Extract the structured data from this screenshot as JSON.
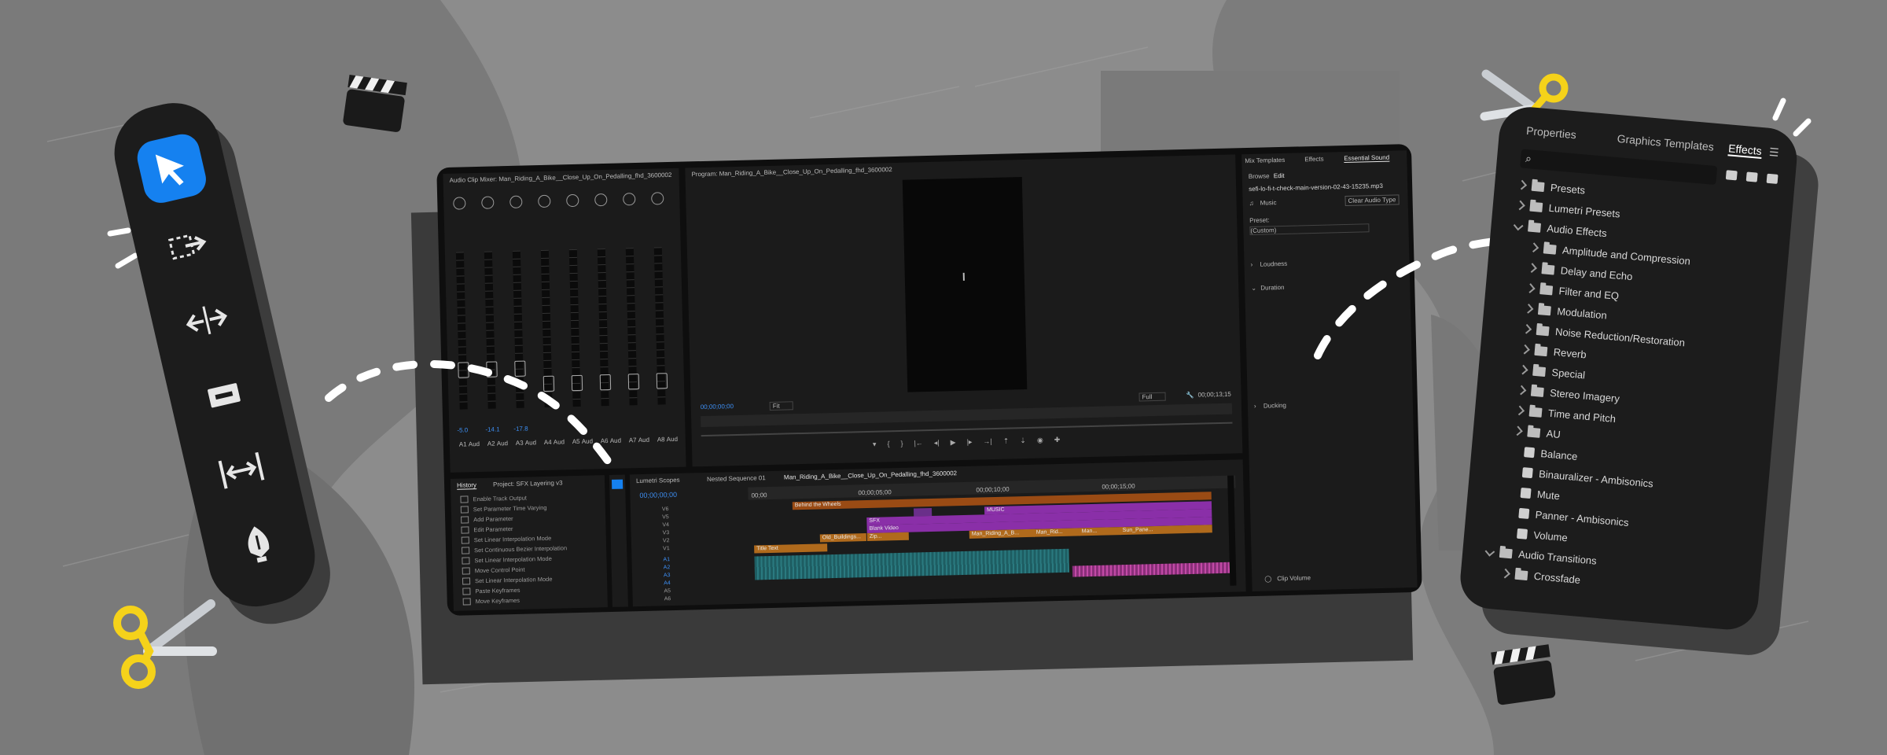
{
  "colors": {
    "background": "#8a8a8a",
    "accent_blue": "#1581f0",
    "scissors_yellow": "#f5d21a",
    "panel_dark": "#1c1c1c"
  },
  "tool_palette": {
    "tools": [
      {
        "icon": "selection-arrow-icon",
        "selected": true
      },
      {
        "icon": "track-select-icon",
        "selected": false
      },
      {
        "icon": "ripple-edit-icon",
        "selected": false
      },
      {
        "icon": "razor-icon",
        "selected": false
      },
      {
        "icon": "slip-icon",
        "selected": false
      },
      {
        "icon": "pen-icon",
        "selected": false
      }
    ]
  },
  "main_window": {
    "audio_mixer": {
      "title": "Audio Clip Mixer: Man_Riding_A_Bike__Close_Up_On_Pedalling_fhd_3600002",
      "channel_labels": [
        "A1",
        "A2",
        "A3",
        "A4",
        "A5",
        "A6",
        "A7",
        "A8"
      ],
      "channel_sublabels": [
        "Aud",
        "Aud",
        "Aud",
        "Aud",
        "Aud",
        "Aud",
        "Aud",
        "Aud"
      ],
      "levels": [
        "-5.0",
        "-14.1",
        "-17.8",
        "",
        "",
        "",
        "",
        ""
      ]
    },
    "program_monitor": {
      "title": "Program: Man_Riding_A_Bike__Close_Up_On_Pedalling_fhd_3600002",
      "timecode_in": "00;00;00;00",
      "fit": "Fit",
      "quality": "Full",
      "timecode_out": "00;00;13;15"
    },
    "history": {
      "tabs": [
        "History",
        "Project: SFX Layering v3"
      ],
      "items": [
        "Enable Track Output",
        "Set Parameter Time Varying",
        "Add Parameter",
        "Edit Parameter",
        "Set Linear Interpolation Mode",
        "Set Continuous Bezier Interpolation",
        "Set Linear Interpolation Mode",
        "Move Control Point",
        "Set Linear Interpolation Mode",
        "Paste Keyframes",
        "Move Keyframes"
      ]
    },
    "timeline": {
      "tabs": [
        "Lumetri Scopes",
        "Nested Sequence 01",
        "Man_Riding_A_Bike__Close_Up_On_Pedalling_fhd_3600002"
      ],
      "timecode": "00;00;00;00",
      "ruler": [
        "00;00",
        "00;00;05;00",
        "00;00;10;00",
        "00;00;15;00"
      ],
      "video_tracks": [
        "V6",
        "V5",
        "V4",
        "V3",
        "V2",
        "V1"
      ],
      "audio_tracks": [
        "A1",
        "A2",
        "A3",
        "A4",
        "A5",
        "A6"
      ],
      "clips": {
        "behind": "Behind the Wheels",
        "music": "MUSIC",
        "sfx": "SFX",
        "blank": "Blank Video",
        "zip": "Zip...",
        "old": "Old_Buildings...",
        "man1": "Man_Riding_A_B...",
        "man2": "Man_Rid...",
        "man3": "Man...",
        "sun": "Sun_Pane...",
        "title": "Title Text"
      }
    },
    "right_panel": {
      "tabs": [
        "Mix Templates",
        "Effects",
        "Essential Sound"
      ],
      "subtabs": [
        "Browse",
        "Edit"
      ],
      "filename": "sefi-lo-fi-t-check-main-version-02-43-15235.mp3",
      "type": "Music",
      "clear_button": "Clear Audio Type",
      "preset_label": "Preset:",
      "preset_value": "(Custom)",
      "sections": [
        "Loudness",
        "Duration",
        "Ducking"
      ],
      "clip_volume": "Clip Volume"
    }
  },
  "effects_panel": {
    "tabs": [
      "Properties",
      "Graphics Templates",
      "Effects"
    ],
    "tree": [
      {
        "label": "Presets",
        "depth": 0,
        "expanded": false,
        "kind": "folder-special"
      },
      {
        "label": "Lumetri Presets",
        "depth": 0,
        "expanded": false,
        "kind": "folder-special"
      },
      {
        "label": "Audio Effects",
        "depth": 0,
        "expanded": true,
        "kind": "folder"
      },
      {
        "label": "Amplitude and Compression",
        "depth": 1,
        "expanded": false,
        "kind": "folder"
      },
      {
        "label": "Delay and Echo",
        "depth": 1,
        "expanded": false,
        "kind": "folder"
      },
      {
        "label": "Filter and EQ",
        "depth": 1,
        "expanded": false,
        "kind": "folder"
      },
      {
        "label": "Modulation",
        "depth": 1,
        "expanded": false,
        "kind": "folder"
      },
      {
        "label": "Noise Reduction/Restoration",
        "depth": 1,
        "expanded": false,
        "kind": "folder"
      },
      {
        "label": "Reverb",
        "depth": 1,
        "expanded": false,
        "kind": "folder"
      },
      {
        "label": "Special",
        "depth": 1,
        "expanded": false,
        "kind": "folder"
      },
      {
        "label": "Stereo Imagery",
        "depth": 1,
        "expanded": false,
        "kind": "folder"
      },
      {
        "label": "Time and Pitch",
        "depth": 1,
        "expanded": false,
        "kind": "folder"
      },
      {
        "label": "AU",
        "depth": 1,
        "expanded": false,
        "kind": "folder"
      },
      {
        "label": "Balance",
        "depth": 1,
        "expanded": null,
        "kind": "effect"
      },
      {
        "label": "Binauralizer - Ambisonics",
        "depth": 1,
        "expanded": null,
        "kind": "effect"
      },
      {
        "label": "Mute",
        "depth": 1,
        "expanded": null,
        "kind": "effect"
      },
      {
        "label": "Panner - Ambisonics",
        "depth": 1,
        "expanded": null,
        "kind": "effect"
      },
      {
        "label": "Volume",
        "depth": 1,
        "expanded": null,
        "kind": "effect"
      },
      {
        "label": "Audio Transitions",
        "depth": 0,
        "expanded": true,
        "kind": "folder"
      },
      {
        "label": "Crossfade",
        "depth": 1,
        "expanded": false,
        "kind": "folder"
      }
    ]
  }
}
